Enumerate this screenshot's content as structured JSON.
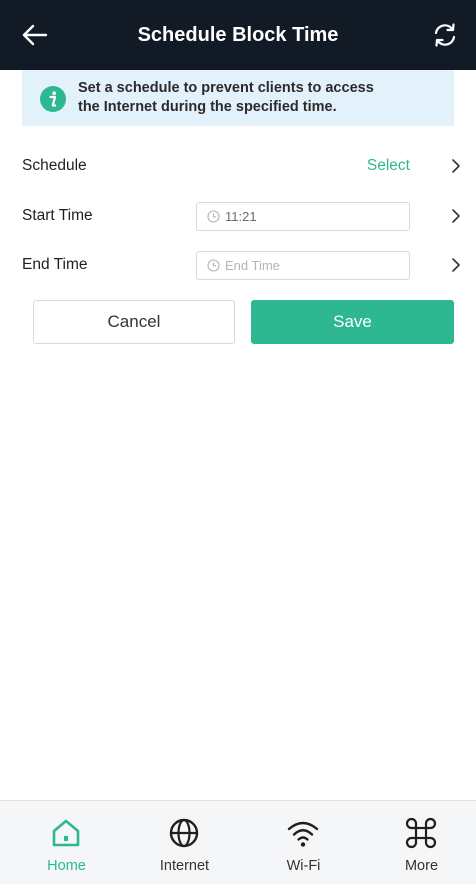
{
  "header": {
    "title": "Schedule Block Time",
    "back_icon": "arrow-left-icon",
    "refresh_icon": "refresh-icon"
  },
  "banner": {
    "icon": "info-icon",
    "message_line1": "Set a schedule to prevent clients to access",
    "message_line2": "the Internet during the specified time."
  },
  "form": {
    "schedule": {
      "label": "Schedule",
      "value": "Select"
    },
    "start_time": {
      "label": "Start Time",
      "value": "11:21"
    },
    "end_time": {
      "label": "End Time",
      "placeholder": "End Time"
    }
  },
  "buttons": {
    "cancel": "Cancel",
    "save": "Save"
  },
  "bottom_nav": {
    "items": [
      {
        "label": "Home",
        "icon": "home-icon",
        "active": true
      },
      {
        "label": "Internet",
        "icon": "globe-icon",
        "active": false
      },
      {
        "label": "Wi-Fi",
        "icon": "wifi-icon",
        "active": false
      },
      {
        "label": "More",
        "icon": "command-icon",
        "active": false
      }
    ]
  },
  "colors": {
    "header_bg": "#121a26",
    "accent": "#2db892",
    "banner_bg": "#e3f1fb"
  }
}
